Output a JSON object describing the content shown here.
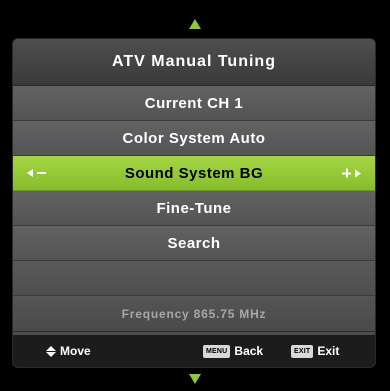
{
  "menu": {
    "title": "ATV Manual Tuning",
    "items": [
      {
        "label": "Current CH 1"
      },
      {
        "label": "Color System Auto"
      },
      {
        "label": "Sound System BG"
      },
      {
        "label": "Fine-Tune"
      },
      {
        "label": "Search"
      }
    ],
    "selected_index": 2,
    "frequency": "Frequency 865.75 MHz"
  },
  "footer": {
    "move_label": "Move",
    "menu_key": "MENU",
    "back_label": "Back",
    "exit_key": "EXIT",
    "exit_label": "Exit"
  },
  "icons": {
    "scroll_up": "triangle-up-icon",
    "scroll_down": "triangle-down-icon",
    "adjust_left": "left-arrow-icon",
    "adjust_right": "right-arrow-icon",
    "minus": "minus-icon",
    "plus": "plus-icon",
    "move": "up-down-arrows-icon"
  },
  "colors": {
    "accent": "#8dc63f",
    "panel": "#565656",
    "footer": "#1c1c1c",
    "frequency_text": "#a8a8a8"
  }
}
